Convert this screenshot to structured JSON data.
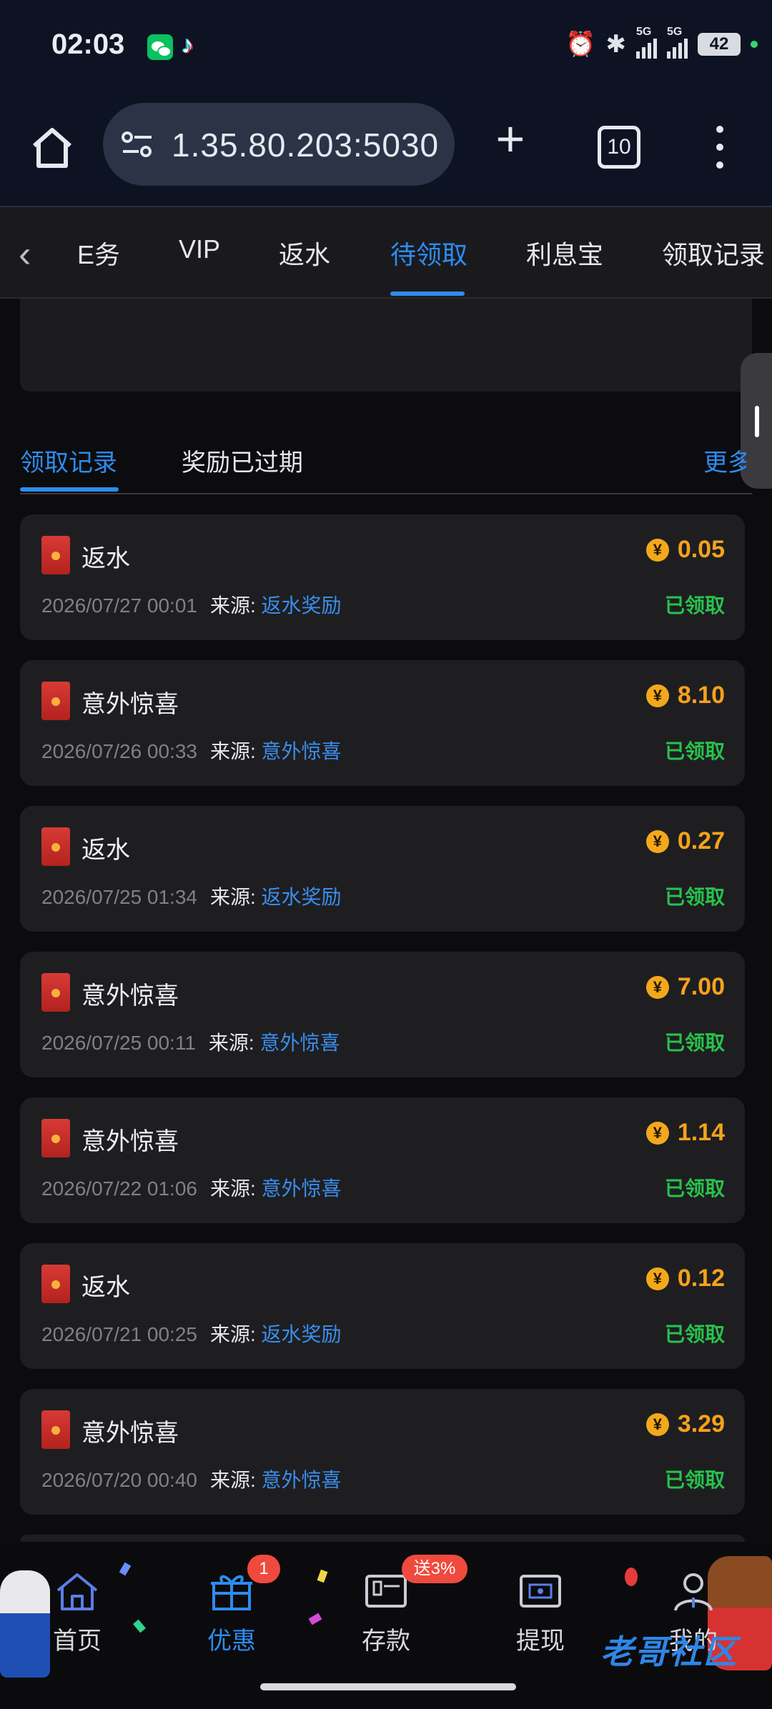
{
  "status_bar": {
    "time": "02:03",
    "battery": "42",
    "icons": [
      "wechat-icon",
      "tiktok-icon",
      "alarm-icon",
      "bluetooth-icon",
      "signal-5g-icon",
      "signal-5g-icon",
      "battery-icon"
    ],
    "signal_label": "5G"
  },
  "browser": {
    "url": "1.35.80.203:5030",
    "tab_count": "10"
  },
  "top_nav": {
    "items": [
      "任务",
      "VIP",
      "返水",
      "待领取",
      "利息宝",
      "领取记录"
    ],
    "active_index": 3,
    "first_partial": "E务"
  },
  "sub_tabs": {
    "items": [
      "领取记录",
      "奖励已过期"
    ],
    "more": "更多"
  },
  "records": [
    {
      "title": "返水",
      "date": "2026/07/27 00:01",
      "source_label": "来源:",
      "source": "返水奖励",
      "amount": "0.05",
      "status": "已领取"
    },
    {
      "title": "意外惊喜",
      "date": "2026/07/26 00:33",
      "source_label": "来源:",
      "source": "意外惊喜",
      "amount": "8.10",
      "status": "已领取"
    },
    {
      "title": "返水",
      "date": "2026/07/25 01:34",
      "source_label": "来源:",
      "source": "返水奖励",
      "amount": "0.27",
      "status": "已领取"
    },
    {
      "title": "意外惊喜",
      "date": "2026/07/25 00:11",
      "source_label": "来源:",
      "source": "意外惊喜",
      "amount": "7.00",
      "status": "已领取"
    },
    {
      "title": "意外惊喜",
      "date": "2026/07/22 01:06",
      "source_label": "来源:",
      "source": "意外惊喜",
      "amount": "1.14",
      "status": "已领取"
    },
    {
      "title": "返水",
      "date": "2026/07/21 00:25",
      "source_label": "来源:",
      "source": "返水奖励",
      "amount": "0.12",
      "status": "已领取"
    },
    {
      "title": "意外惊喜",
      "date": "2026/07/20 00:40",
      "source_label": "来源:",
      "source": "意外惊喜",
      "amount": "3.29",
      "status": "已领取"
    }
  ],
  "coin_symbol": "¥",
  "bottom_nav": {
    "items": [
      {
        "label": "首页",
        "icon": "home-icon"
      },
      {
        "label": "优惠",
        "icon": "gift-icon"
      },
      {
        "label": "存款",
        "icon": "wallet-icon"
      },
      {
        "label": "提现",
        "icon": "withdraw-icon"
      },
      {
        "label": "我的",
        "icon": "user-icon"
      }
    ],
    "active_index": 1,
    "promo_badge_count": "1",
    "deposit_badge": "送3%"
  },
  "watermark": "老哥社区",
  "colors": {
    "accent": "#2d8cf0",
    "amount": "#f5a21b",
    "claimed": "#27c24c",
    "card": "#1e1e21",
    "background": "#0c0c0e"
  }
}
